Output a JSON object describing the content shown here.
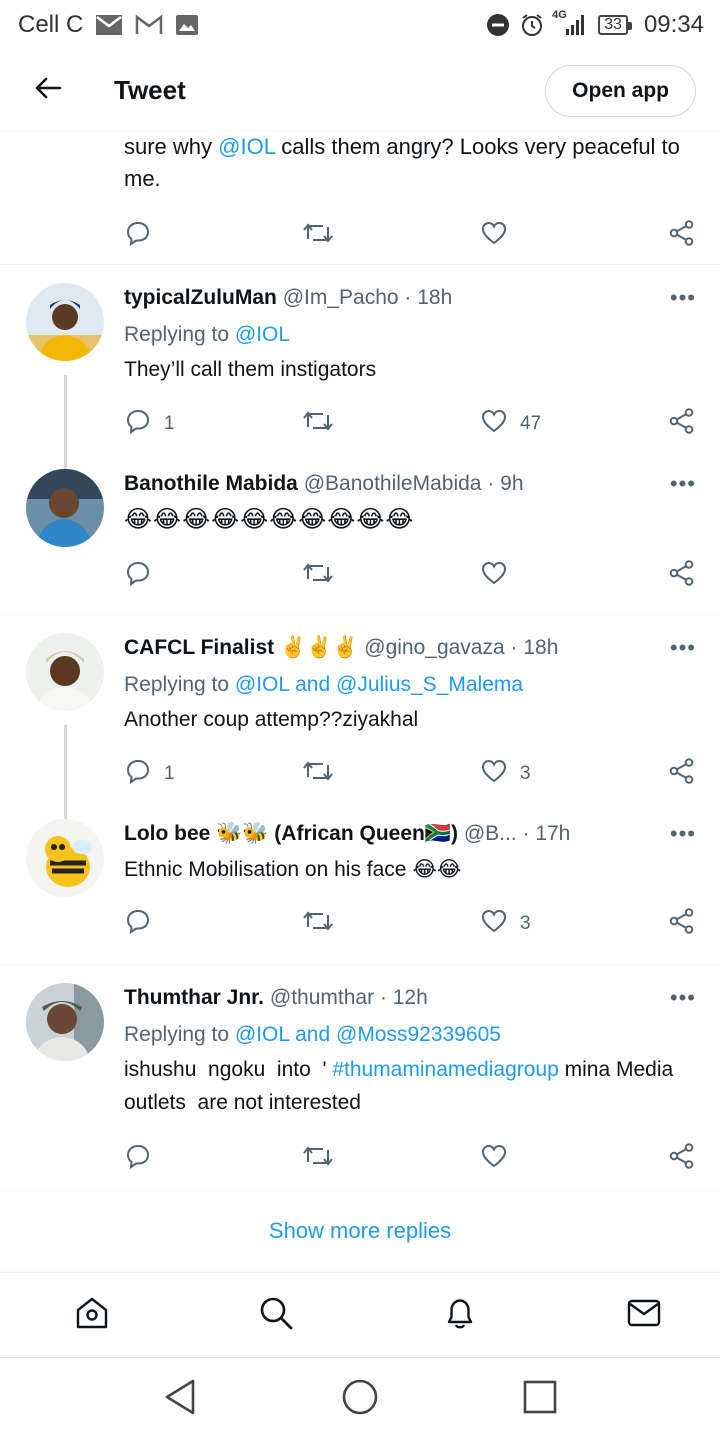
{
  "status_bar": {
    "carrier": "Cell C",
    "network": "4G",
    "battery": "33",
    "time": "09:34"
  },
  "header": {
    "title": "Tweet",
    "open_app": "Open app"
  },
  "partial_tweet": {
    "text_before": "sure why ",
    "mention": "@IOL",
    "text_after": " calls them angry? Looks very peaceful to me."
  },
  "tweets": [
    {
      "name": "typicalZuluMan",
      "handle": "@Im_Pacho",
      "time": "· 18h",
      "replying_label": "Replying to ",
      "replying_to": "@IOL",
      "text": "They’ll call them instigators",
      "replies": "1",
      "retweets": "",
      "likes": "47"
    },
    {
      "name": "Banothile Mabida",
      "handle": "@BanothileMabida",
      "time": "· 9h",
      "text": "😂😂😂😂😂😂😂😂😂😂",
      "replies": "",
      "retweets": "",
      "likes": ""
    },
    {
      "name": "CAFCL Finalist ✌️✌️✌️",
      "handle": "@gino_gavaza",
      "time": "· 18h",
      "replying_label": "Replying to ",
      "replying_to": "@IOL and @Julius_S_Malema",
      "text": "Another coup attemp??ziyakhal",
      "replies": "1",
      "retweets": "",
      "likes": "3"
    },
    {
      "name": "Lolo bee 🐝🐝 (African Queen🇿🇦)",
      "handle": "@B...",
      "time": "· 17h",
      "text": "Ethnic Mobilisation on his face 😂😂",
      "replies": "",
      "retweets": "",
      "likes": "3"
    },
    {
      "name": "Thumthar Jnr.",
      "handle": "@thumthar",
      "time": "· 12h",
      "replying_label": "Replying to ",
      "replying_to": "@IOL and @Moss92339605",
      "text_before": "ishushu  ngoku  into  ' ",
      "hashtag": "#thumaminamediagroup",
      "text_after": " mina Media  outlets  are not interested",
      "replies": "",
      "retweets": "",
      "likes": ""
    }
  ],
  "show_more": "Show more replies",
  "more_label": "•••",
  "icons": {
    "back": "arrow-left-icon",
    "reply": "reply-icon",
    "retweet": "retweet-icon",
    "like": "heart-icon",
    "share": "share-icon",
    "home": "home-icon",
    "search": "search-icon",
    "notifications": "bell-icon",
    "messages": "mail-icon"
  },
  "colors": {
    "accent": "#1d9bf0",
    "text": "#0f1419",
    "muted": "#536471",
    "border": "#eff3f4"
  }
}
